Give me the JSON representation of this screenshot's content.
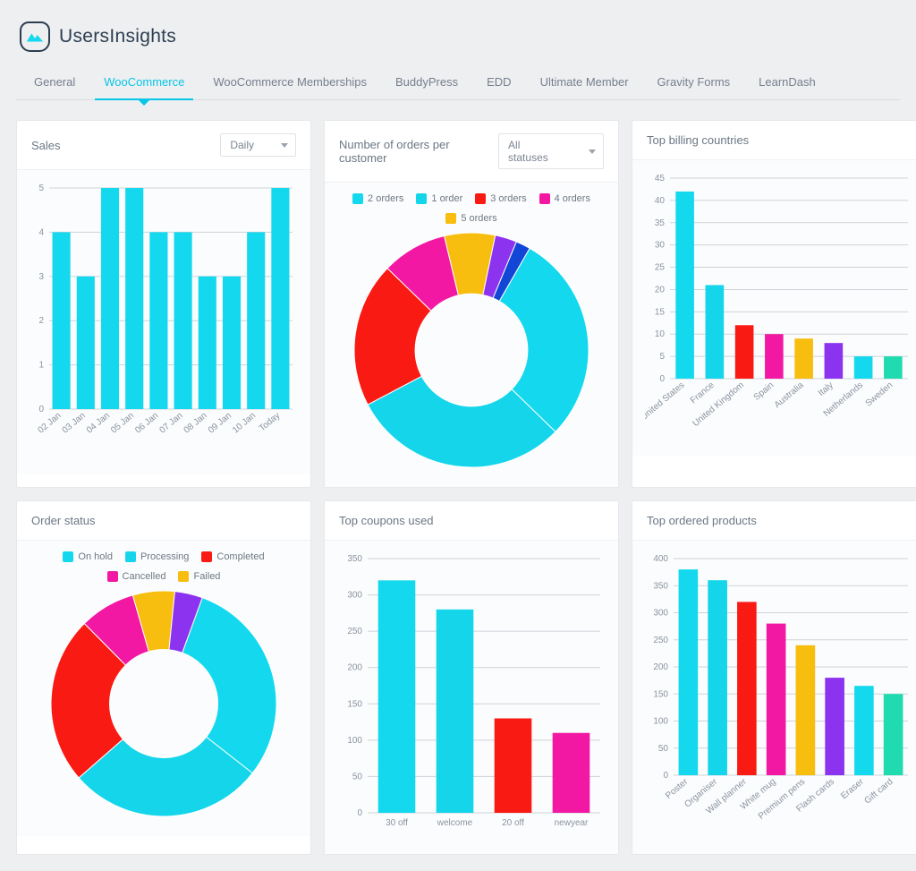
{
  "brand": {
    "name": "UsersInsights"
  },
  "tabs": [
    "General",
    "WooCommerce",
    "WooCommerce Memberships",
    "BuddyPress",
    "EDD",
    "Ultimate Member",
    "Gravity Forms",
    "LearnDash"
  ],
  "active_tab": "WooCommerce",
  "palette": {
    "cyan": "#14d9ee",
    "cyan2": "#14d5ea",
    "red": "#f91b13",
    "magenta": "#f318a3",
    "yellow": "#f7bd0f",
    "purple": "#8c33ef",
    "blue": "#1246d6",
    "teal": "#20dbb0"
  },
  "cards": {
    "sales": {
      "title": "Sales",
      "select": "Daily"
    },
    "orders_per_customer": {
      "title": "Number of orders per customer",
      "select": "All statuses"
    },
    "billing": {
      "title": "Top billing countries"
    },
    "order_status": {
      "title": "Order status"
    },
    "coupons": {
      "title": "Top coupons used"
    },
    "products": {
      "title": "Top ordered products"
    }
  },
  "chart_data": [
    {
      "id": "sales",
      "type": "bar",
      "categories": [
        "02 Jan",
        "03 Jan",
        "04 Jan",
        "05 Jan",
        "06 Jan",
        "07 Jan",
        "08 Jan",
        "09 Jan",
        "10 Jan",
        "Today"
      ],
      "values": [
        4,
        3,
        5,
        5,
        4,
        4,
        3,
        3,
        4,
        5
      ],
      "ylim": [
        0,
        5
      ],
      "yticks": [
        0,
        1,
        2,
        3,
        4,
        5
      ],
      "colors": [
        "cyan"
      ]
    },
    {
      "id": "orders_per_customer",
      "type": "donut",
      "series": [
        {
          "name": "2 orders",
          "value": 29,
          "color": "cyan"
        },
        {
          "name": "1 order",
          "value": 30,
          "color": "cyan2"
        },
        {
          "name": "3 orders",
          "value": 20,
          "color": "red"
        },
        {
          "name": "4 orders",
          "value": 9,
          "color": "magenta"
        },
        {
          "name": "5 orders",
          "value": 7,
          "color": "yellow"
        },
        {
          "name": "",
          "value": 3,
          "color": "purple"
        },
        {
          "name": "",
          "value": 2,
          "color": "blue"
        }
      ],
      "legend": [
        "2 orders",
        "1 order",
        "3 orders",
        "4 orders",
        "5 orders"
      ]
    },
    {
      "id": "billing",
      "type": "bar",
      "categories": [
        "United States",
        "France",
        "United Kingdom",
        "Spain",
        "Australia",
        "Italy",
        "Netherlands",
        "Sweden"
      ],
      "values": [
        42,
        21,
        12,
        10,
        9,
        8,
        5,
        5
      ],
      "colors": [
        "cyan",
        "cyan2",
        "red",
        "magenta",
        "yellow",
        "purple",
        "cyan",
        "teal"
      ],
      "ylim": [
        0,
        45
      ],
      "yticks": [
        0,
        5,
        10,
        15,
        20,
        25,
        30,
        35,
        40,
        45
      ]
    },
    {
      "id": "order_status",
      "type": "donut",
      "series": [
        {
          "name": "On hold",
          "value": 30,
          "color": "cyan"
        },
        {
          "name": "Processing",
          "value": 28,
          "color": "cyan2"
        },
        {
          "name": "Completed",
          "value": 24,
          "color": "red"
        },
        {
          "name": "Cancelled",
          "value": 8,
          "color": "magenta"
        },
        {
          "name": "Failed",
          "value": 6,
          "color": "yellow"
        },
        {
          "name": "",
          "value": 4,
          "color": "purple"
        }
      ],
      "legend": [
        "On hold",
        "Processing",
        "Completed",
        "Cancelled",
        "Failed"
      ]
    },
    {
      "id": "coupons",
      "type": "bar",
      "categories": [
        "30 off",
        "welcome",
        "20 off",
        "newyear"
      ],
      "values": [
        320,
        280,
        130,
        110
      ],
      "colors": [
        "cyan",
        "cyan2",
        "red",
        "magenta"
      ],
      "ylim": [
        0,
        350
      ],
      "yticks": [
        0,
        50,
        100,
        150,
        200,
        250,
        300,
        350
      ]
    },
    {
      "id": "products",
      "type": "bar",
      "categories": [
        "Poster",
        "Organiser",
        "Wall planner",
        "White mug",
        "Premium pens",
        "Flash cards",
        "Eraser",
        "Gift card"
      ],
      "values": [
        380,
        360,
        320,
        280,
        240,
        180,
        165,
        150
      ],
      "colors": [
        "cyan",
        "cyan2",
        "red",
        "magenta",
        "yellow",
        "purple",
        "cyan",
        "teal"
      ],
      "ylim": [
        0,
        400
      ],
      "yticks": [
        0,
        50,
        100,
        150,
        200,
        250,
        300,
        350,
        400
      ]
    }
  ]
}
